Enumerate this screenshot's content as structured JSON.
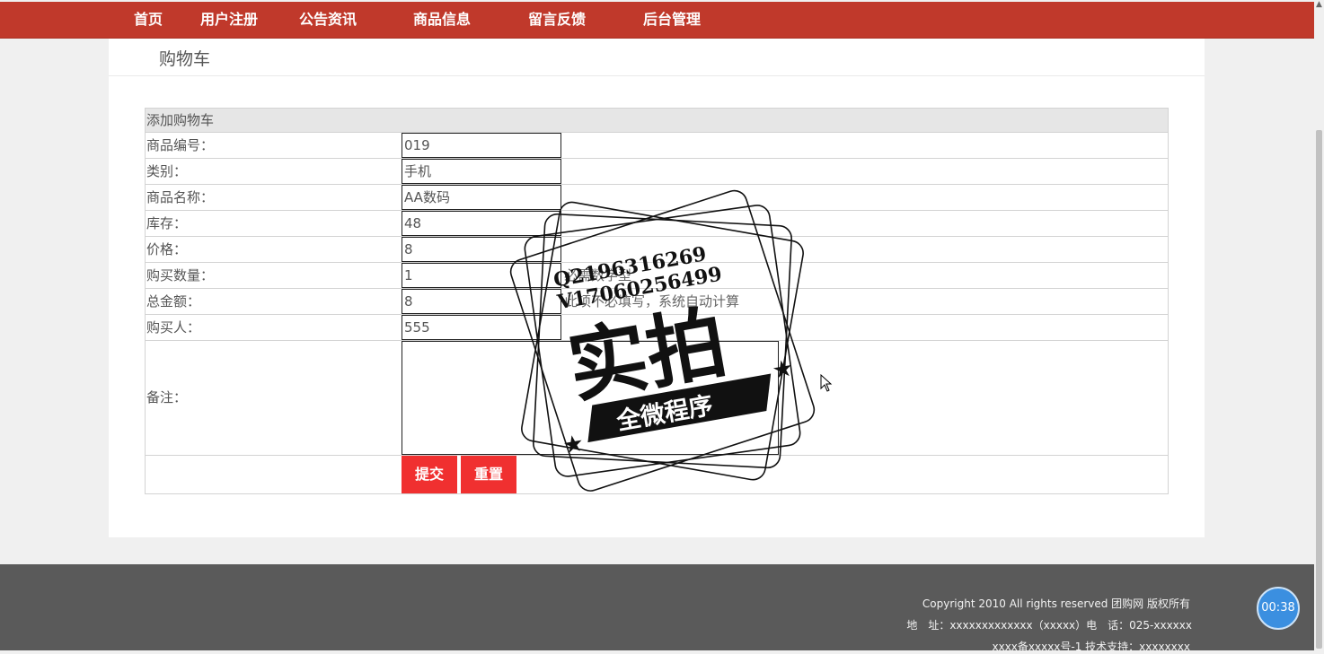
{
  "nav": {
    "items": [
      "首页",
      "用户注册",
      "公告资讯",
      "商品信息",
      "留言反馈",
      "后台管理"
    ]
  },
  "page": {
    "heading": "购物车"
  },
  "form": {
    "caption": "添加购物车",
    "fields": [
      {
        "label": "商品编号：",
        "value": "019"
      },
      {
        "label": "类别：",
        "value": "手机"
      },
      {
        "label": "商品名称：",
        "value": "AA数码"
      },
      {
        "label": "库存：",
        "value": "48"
      },
      {
        "label": "价格：",
        "value": "8"
      },
      {
        "label": "购买数量：",
        "value": "1",
        "hint": "必需数字型"
      },
      {
        "label": "总金额：",
        "value": "8",
        "hint": "此项不必填写，系统自动计算"
      },
      {
        "label": "购买人：",
        "value": "555"
      }
    ],
    "remark_label": "备注：",
    "remark_value": "",
    "submit_label": "提交",
    "reset_label": "重置"
  },
  "footer": {
    "copyright": "Copyright 2010 All rights reserved 团购网 版权所有",
    "address": "地　址：xxxxxxxxxxxxx（xxxxx）电　话：025-xxxxxx",
    "icp": "xxxx备xxxxx号-1 技术支持：xxxxxxxx"
  },
  "timer": {
    "text": "00:38"
  },
  "watermark": {
    "qq": "Q2196316269",
    "vx": "V17060256499",
    "big": "实拍",
    "banner": "全微程序"
  },
  "colors": {
    "nav_bg": "#c0392b",
    "button_bg": "#f03030",
    "footer_bg": "#5a5a5a",
    "timer_bg": "#3b8fe0"
  }
}
